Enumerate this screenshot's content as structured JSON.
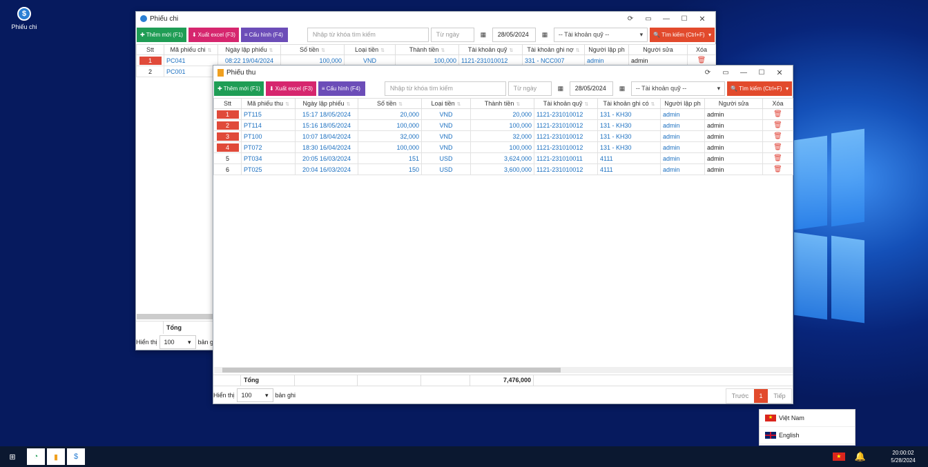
{
  "desktop": {
    "icon_label": "Phiếu chi"
  },
  "chi": {
    "title": "Phiếu chi",
    "buttons": {
      "new": "Thêm mới (F1)",
      "excel": "Xuất excel (F3)",
      "config": "Cấu hình (F4)",
      "search": "Tìm kiếm (Ctrl+F)"
    },
    "search_placeholder": "Nhập từ khóa tìm kiếm",
    "from_date": "Từ ngày",
    "to_date": "28/05/2024",
    "account_select": "-- Tài khoản quỹ --",
    "columns": [
      "Stt",
      "Mã phiếu chi",
      "Ngày lập phiếu",
      "Số tiền",
      "Loại tiền",
      "Thành tiền",
      "Tài khoản quỹ",
      "Tài khoản ghi nợ",
      "Người lập ph",
      "Người sửa",
      "Xóa"
    ],
    "rows": [
      {
        "stt": "1",
        "code": "PC041",
        "date": "08:22 19/04/2024",
        "amount": "100,000",
        "cur": "VND",
        "total": "100,000",
        "fund": "1121-231010012",
        "acc": "331 - NCC007",
        "creator": "admin",
        "editor": "admin"
      },
      {
        "stt": "2",
        "code": "PC001"
      }
    ],
    "total_label": "Tổng",
    "show_label": "Hiển thị",
    "page_size": "100",
    "records_label": "bản g"
  },
  "thu": {
    "title": "Phiếu thu",
    "buttons": {
      "new": "Thêm mới (F1)",
      "excel": "Xuất excel (F3)",
      "config": "Cấu hình (F4)",
      "search": "Tìm kiếm (Ctrl+F)"
    },
    "search_placeholder": "Nhập từ khóa tìm kiếm",
    "from_date": "Từ ngày",
    "to_date": "28/05/2024",
    "account_select": "-- Tài khoản quỹ --",
    "columns": [
      "Stt",
      "Mã phiếu thu",
      "Ngày lập phiếu",
      "Số tiền",
      "Loại tiền",
      "Thành tiền",
      "Tài khoản quỹ",
      "Tài khoản ghi có",
      "Người lập ph",
      "Người sửa",
      "Xóa"
    ],
    "rows": [
      {
        "stt": "1",
        "code": "PT115",
        "date": "15:17 18/05/2024",
        "amount": "20,000",
        "cur": "VND",
        "total": "20,000",
        "fund": "1121-231010012",
        "acc": "131 - KH30",
        "creator": "admin",
        "editor": "admin",
        "badge": true
      },
      {
        "stt": "2",
        "code": "PT114",
        "date": "15:16 18/05/2024",
        "amount": "100,000",
        "cur": "VND",
        "total": "100,000",
        "fund": "1121-231010012",
        "acc": "131 - KH30",
        "creator": "admin",
        "editor": "admin",
        "badge": true
      },
      {
        "stt": "3",
        "code": "PT100",
        "date": "10:07 18/04/2024",
        "amount": "32,000",
        "cur": "VND",
        "total": "32,000",
        "fund": "1121-231010012",
        "acc": "131 - KH30",
        "creator": "admin",
        "editor": "admin",
        "badge": true
      },
      {
        "stt": "4",
        "code": "PT072",
        "date": "18:30 16/04/2024",
        "amount": "100,000",
        "cur": "VND",
        "total": "100,000",
        "fund": "1121-231010012",
        "acc": "131 - KH30",
        "creator": "admin",
        "editor": "admin",
        "badge": true
      },
      {
        "stt": "5",
        "code": "PT034",
        "date": "20:05 16/03/2024",
        "amount": "151",
        "cur": "USD",
        "total": "3,624,000",
        "fund": "1121-231010011",
        "acc": "4111",
        "creator": "admin",
        "editor": "admin",
        "badge": false
      },
      {
        "stt": "6",
        "code": "PT025",
        "date": "20:04 16/03/2024",
        "amount": "150",
        "cur": "USD",
        "total": "3,600,000",
        "fund": "1121-231010012",
        "acc": "4111",
        "creator": "admin",
        "editor": "admin",
        "badge": false
      }
    ],
    "total_label": "Tổng",
    "grand_total": "7,476,000",
    "show_label": "Hiển thị",
    "page_size": "100",
    "records_label": "bản ghi",
    "pager": {
      "prev": "Trước",
      "current": "1",
      "next": "Tiếp"
    }
  },
  "lang_menu": [
    "Việt Nam",
    "English"
  ],
  "tray": {
    "time": "20:00:02",
    "date": "5/28/2024"
  }
}
